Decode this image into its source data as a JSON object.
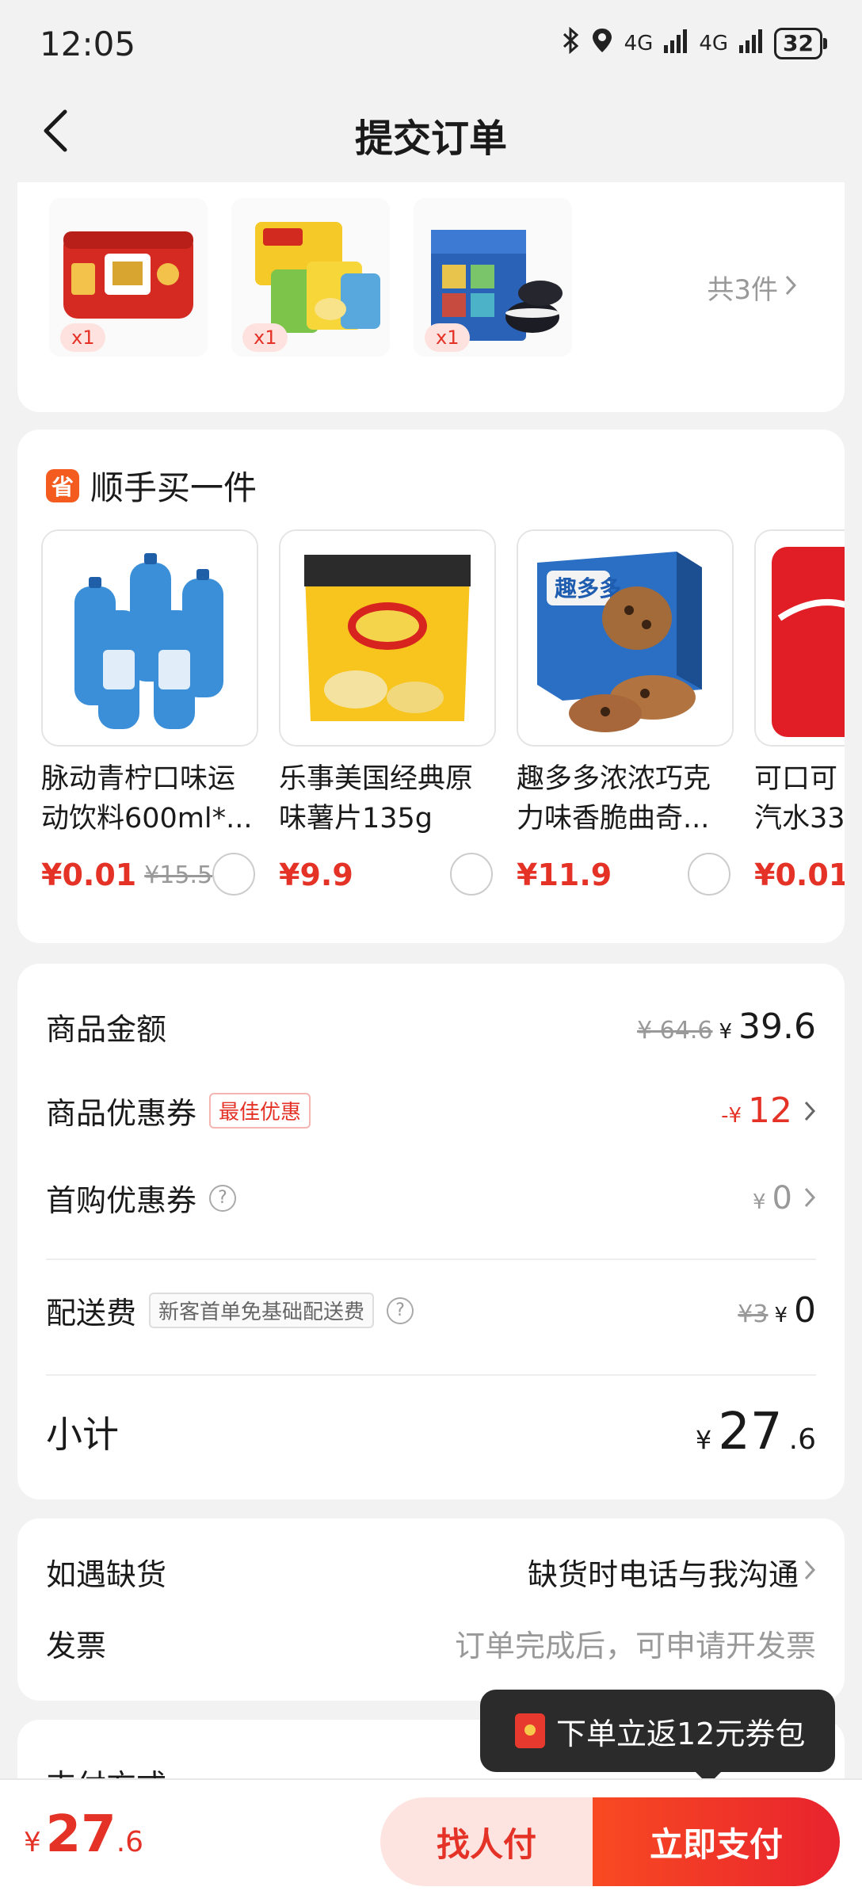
{
  "status_bar": {
    "time": "12:05",
    "signal_1": "4G",
    "signal_2": "4G",
    "battery": "32"
  },
  "header": {
    "title": "提交订单"
  },
  "products": {
    "items": [
      {
        "name": "drink-can-pack",
        "qty": "x1"
      },
      {
        "name": "lays-chips-pack",
        "qty": "x1"
      },
      {
        "name": "oreo-gift-box",
        "qty": "x1"
      }
    ],
    "count_label": "共3件"
  },
  "addon": {
    "icon_text": "省",
    "title": "顺手买一件",
    "items": [
      {
        "name_line1": "脉动青柠口味运",
        "name_line2": "动饮料600ml*...",
        "price": "¥0.01",
        "orig_price": "¥15.5"
      },
      {
        "name_line1": "乐事美国经典原",
        "name_line2": "味薯片135g",
        "price": "¥9.9",
        "orig_price": ""
      },
      {
        "name_line1": "趣多多浓浓巧克",
        "name_line2": "力味香脆曲奇...",
        "price": "¥11.9",
        "orig_price": ""
      },
      {
        "name_line1": "可口可",
        "name_line2": "汽水33",
        "price": "¥0.01",
        "orig_price": ""
      }
    ]
  },
  "summary": {
    "goods_amount_label": "商品金额",
    "goods_amount_orig": "¥ 64.6",
    "goods_amount_yen": "¥",
    "goods_amount": "39.6",
    "coupon_label": "商品优惠券",
    "coupon_badge": "最佳优惠",
    "coupon_yen": "-¥",
    "coupon_value": "12",
    "first_coupon_label": "首购优惠券",
    "first_coupon_yen": "¥",
    "first_coupon_value": "0",
    "delivery_label": "配送费",
    "delivery_badge": "新客首单免基础配送费",
    "delivery_orig": "¥3",
    "delivery_yen": "¥",
    "delivery_value": "0",
    "subtotal_label": "小计",
    "subtotal_yen": "¥",
    "subtotal_int": "27",
    "subtotal_dec": ".6"
  },
  "options": {
    "stockout_label": "如遇缺货",
    "stockout_value": "缺货时电话与我沟通",
    "invoice_label": "发票",
    "invoice_value": "订单完成后，可申请开发票"
  },
  "payment": {
    "label": "支付方式"
  },
  "tooltip": {
    "text": "下单立返12元券包"
  },
  "bottom": {
    "yen": "¥",
    "total_int": "27",
    "total_dec": ".6",
    "friend_pay": "找人付",
    "pay_now": "立即支付"
  },
  "colors": {
    "accent": "#e53227",
    "save_icon": "#f35b1f",
    "tooltip_bg": "#2b2b2b"
  }
}
